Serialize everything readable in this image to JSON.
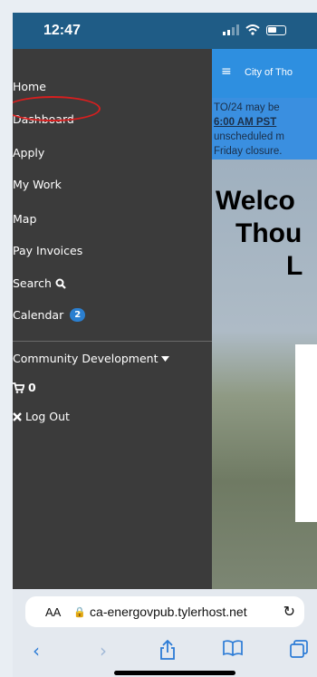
{
  "status": {
    "time": "12:47"
  },
  "drawer": {
    "items": [
      {
        "label": "Home"
      },
      {
        "label": "Dashboard"
      },
      {
        "label": "Apply"
      },
      {
        "label": "My Work"
      },
      {
        "label": "Map"
      },
      {
        "label": "Pay Invoices"
      },
      {
        "label": "Search",
        "icon": "search-icon"
      },
      {
        "label": "Calendar",
        "badge": "2"
      }
    ],
    "community": {
      "label": "Community Development",
      "icon": "caret-down-icon"
    },
    "cart": {
      "count": "0",
      "icon": "cart-icon"
    },
    "logout": {
      "label": "Log Out",
      "icon": "close-icon"
    }
  },
  "content": {
    "hamburger": "≡",
    "title": "City of Tho",
    "notice": {
      "line1": "TO/24 may be",
      "line2": "6:00 AM PST",
      "line3": "unscheduled m",
      "line4": "Friday closure."
    },
    "hero": {
      "line1": "Welco",
      "line2": "Thou",
      "line3": "L"
    }
  },
  "browser": {
    "aa": "AA",
    "url": "ca-energovpub.tylerhost.net"
  },
  "colors": {
    "accent": "#2e8fe0",
    "drawer": "#3b3b3b",
    "highlight": "#d61f1f"
  }
}
